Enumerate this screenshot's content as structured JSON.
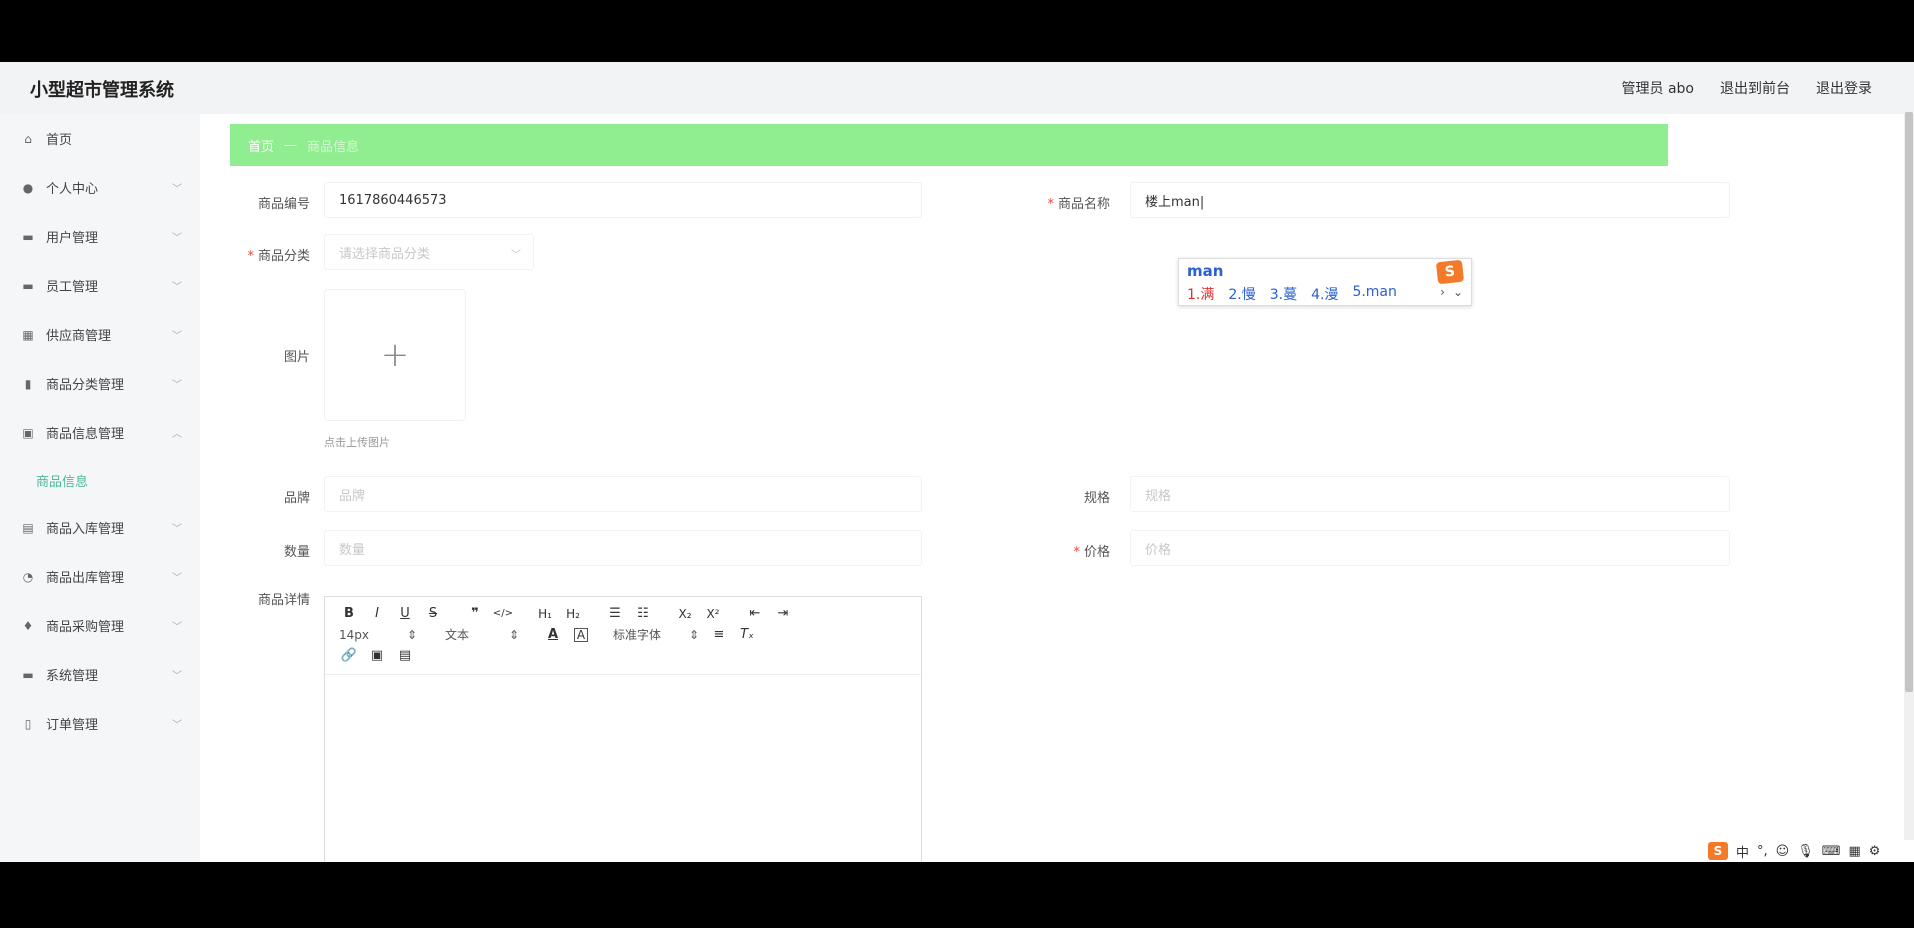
{
  "app": {
    "title": "小型超市管理系统"
  },
  "top_links": {
    "admin": "管理员 abo",
    "frontend": "退出到前台",
    "logout": "退出登录"
  },
  "sidebar": {
    "items": [
      {
        "label": "首页",
        "icon": "home-icon",
        "glyph": "⌂"
      },
      {
        "label": "个人中心",
        "icon": "user-icon",
        "glyph": "●"
      },
      {
        "label": "用户管理",
        "icon": "users-icon",
        "glyph": "▬"
      },
      {
        "label": "员工管理",
        "icon": "staff-icon",
        "glyph": "▬"
      },
      {
        "label": "供应商管理",
        "icon": "supplier-icon",
        "glyph": "▦"
      },
      {
        "label": "商品分类管理",
        "icon": "bar-chart-icon",
        "glyph": "▮"
      },
      {
        "label": "商品信息管理",
        "icon": "goods-icon",
        "glyph": "▣"
      },
      {
        "label": "商品入库管理",
        "icon": "inbound-icon",
        "glyph": "▤"
      },
      {
        "label": "商品出库管理",
        "icon": "outbound-icon",
        "glyph": "◔"
      },
      {
        "label": "商品采购管理",
        "icon": "purchase-icon",
        "glyph": "♦"
      },
      {
        "label": "系统管理",
        "icon": "system-icon",
        "glyph": "▬"
      },
      {
        "label": "订单管理",
        "icon": "order-icon",
        "glyph": "▯"
      }
    ],
    "sub_item": "商品信息"
  },
  "breadcrumb": {
    "home": "首页",
    "separator": "—",
    "current": "商品信息"
  },
  "form": {
    "code_label": "商品编号",
    "code_value": "1617860446573",
    "name_label": "商品名称",
    "name_value": "楼上man|",
    "category_label": "商品分类",
    "category_placeholder": "请选择商品分类",
    "image_label": "图片",
    "upload_tip": "点击上传图片",
    "brand_label": "品牌",
    "brand_placeholder": "品牌",
    "spec_label": "规格",
    "spec_placeholder": "规格",
    "qty_label": "数量",
    "qty_placeholder": "数量",
    "price_label": "价格",
    "price_placeholder": "价格",
    "detail_label": "商品详情"
  },
  "editor": {
    "size": "14px",
    "header": "文本",
    "font": "标准字体"
  },
  "ime": {
    "composition": "man",
    "candidates": [
      "1.满",
      "2.慢",
      "3.蔓",
      "4.漫",
      "5.man"
    ],
    "logo": "S"
  },
  "tray": {
    "lang": "中",
    "logo": "S"
  }
}
